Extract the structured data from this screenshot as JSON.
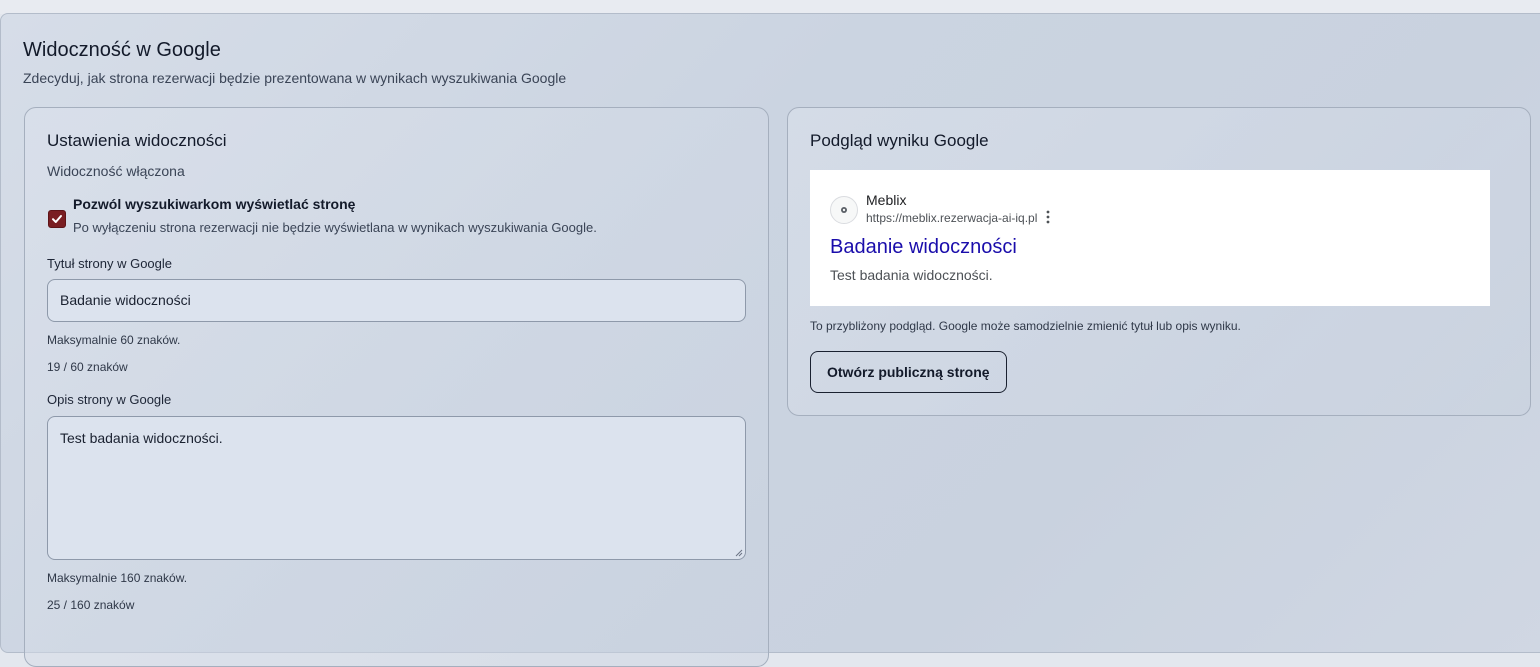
{
  "header": {
    "title": "Widoczność w Google",
    "subtitle": "Zdecyduj, jak strona rezerwacji będzie prezentowana w wynikach wyszukiwania Google"
  },
  "settings": {
    "title": "Ustawienia widoczności",
    "status": "Widoczność włączona",
    "allow_indexing": {
      "checked": true,
      "label": "Pozwól wyszukiwarkom wyświetlać stronę",
      "help": "Po wyłączeniu strona rezerwacji nie będzie wyświetlana w wynikach wyszukiwania Google."
    },
    "page_title": {
      "label": "Tytuł strony w Google",
      "value": "Badanie widoczności",
      "max_hint": "Maksymalnie 60 znaków.",
      "counter": "19 / 60 znaków"
    },
    "page_description": {
      "label": "Opis strony w Google",
      "value": "Test badania widoczności.",
      "max_hint": "Maksymalnie 160 znaków.",
      "counter": "25 / 160 znaków"
    }
  },
  "preview": {
    "title": "Podgląd wyniku Google",
    "result": {
      "site_name": "Meblix",
      "url": "https://meblix.rezerwacja-ai-iq.pl",
      "title": "Badanie widoczności",
      "description": "Test badania widoczności."
    },
    "note": "To przybliżony podgląd. Google może samodzielnie zmienić tytuł lub opis wyniku.",
    "open_button": "Otwórz publiczną stronę"
  },
  "colors": {
    "checkbox": "#7a1e22",
    "serp_link": "#1a0dab"
  }
}
